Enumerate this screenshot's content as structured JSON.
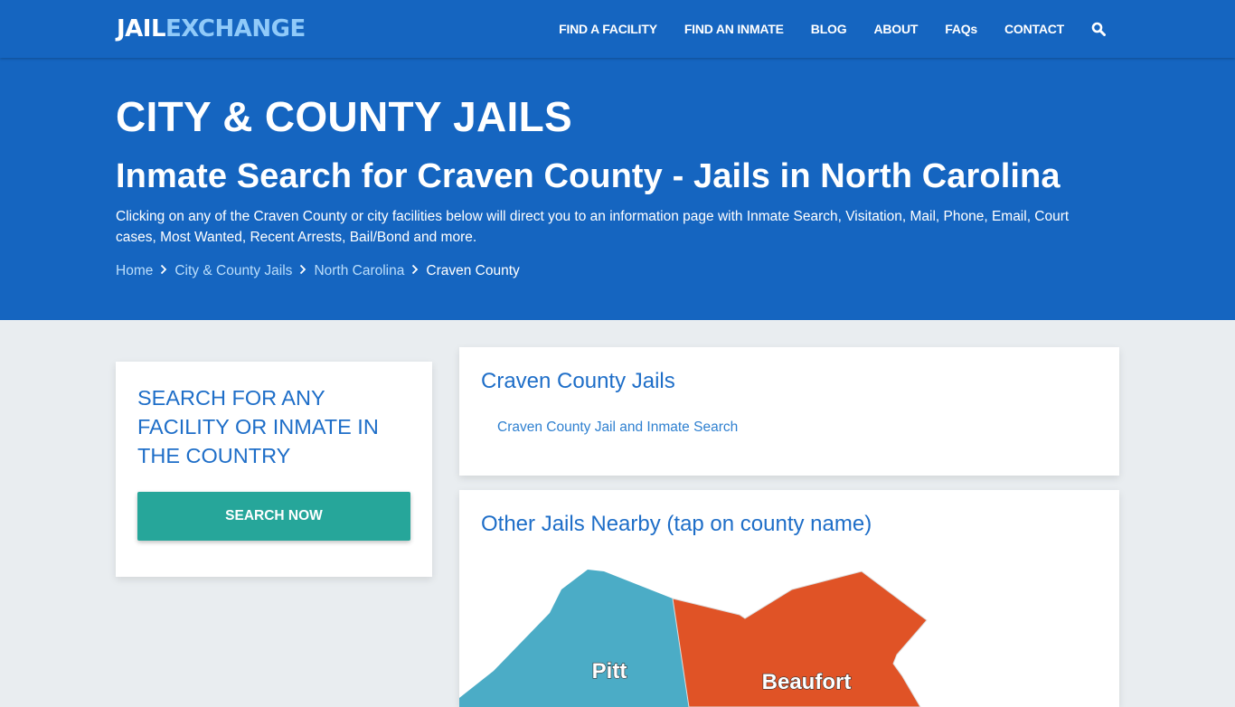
{
  "brand": {
    "part1": "JAIL",
    "part2": "EXCHANGE"
  },
  "nav": {
    "items": [
      {
        "label": "FIND A FACILITY"
      },
      {
        "label": "FIND AN INMATE"
      },
      {
        "label": "BLOG"
      },
      {
        "label": "ABOUT"
      },
      {
        "label": "FAQs"
      },
      {
        "label": "CONTACT"
      }
    ],
    "search_icon": "search-icon"
  },
  "hero": {
    "section_title": "CITY & COUNTY JAILS",
    "page_title": "Inmate Search for Craven County - Jails in North Carolina",
    "description": "Clicking on any of the Craven County or city facilities below will direct you to an information page with Inmate Search, Visitation, Mail, Phone, Email, Court cases, Most Wanted, Recent Arrests, Bail/Bond and more.",
    "breadcrumb": [
      {
        "label": "Home"
      },
      {
        "label": "City & County Jails"
      },
      {
        "label": "North Carolina"
      },
      {
        "label": "Craven County"
      }
    ]
  },
  "sidebar": {
    "heading": "SEARCH FOR ANY FACILITY OR INMATE IN THE COUNTRY",
    "button_label": "SEARCH NOW"
  },
  "jails_card": {
    "heading": "Craven County Jails",
    "links": [
      {
        "label": "Craven County Jail and Inmate Search"
      }
    ]
  },
  "nearby_card": {
    "heading": "Other Jails Nearby (tap on county name)",
    "counties": [
      {
        "name": "Pitt",
        "color": "#4bacc6"
      },
      {
        "name": "Beaufort",
        "color": "#e05326"
      }
    ]
  },
  "colors": {
    "primary": "#1565c0",
    "accent_button": "#26a69a",
    "heading_blue": "#1e6ec8",
    "background": "#e9edf0"
  }
}
